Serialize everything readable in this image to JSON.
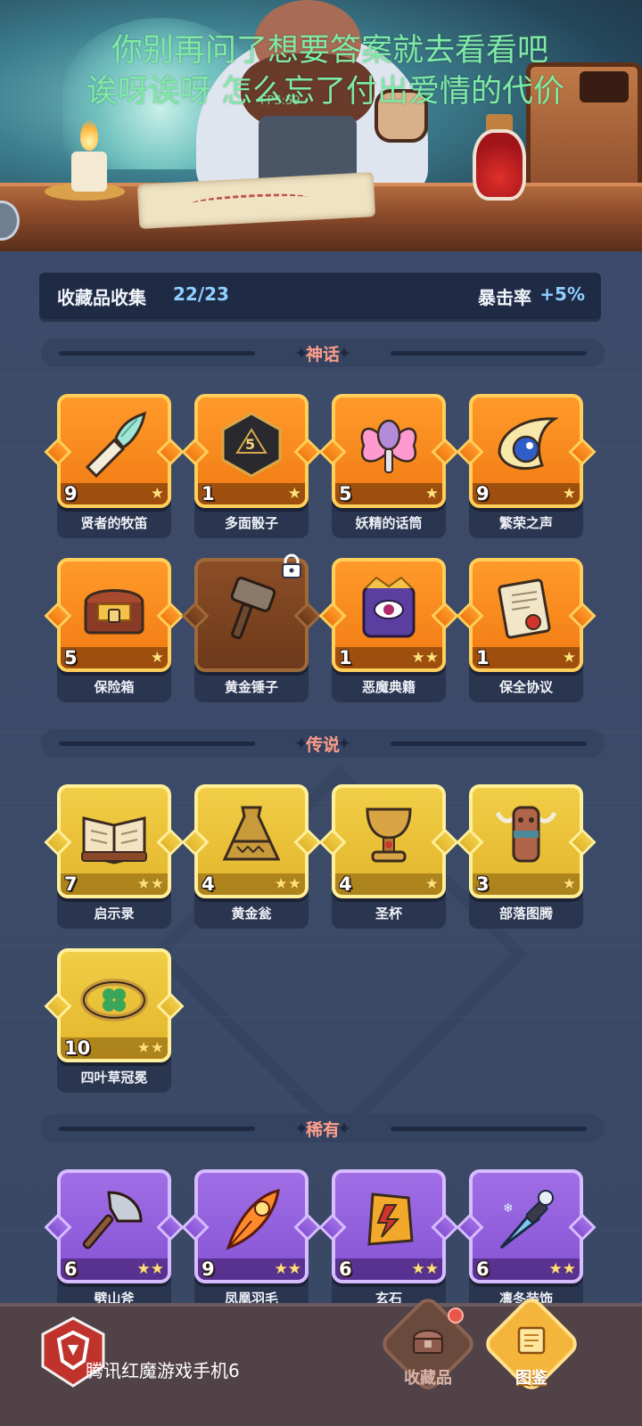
{
  "overlay": {
    "lyric_line1": "你别再问了想要答案就去看看吧",
    "lyric_line2": "诶呀诶呀 怎么忘了付出爱情的代价",
    "fps": "FPS:59"
  },
  "stats": {
    "label": "收藏品收集",
    "count": "22/23",
    "crit_label": "暴击率",
    "crit_value": "+5%"
  },
  "sections": {
    "mythic": {
      "title": "神话",
      "items": [
        {
          "name": "贤者的牧笛",
          "level": "9",
          "stars": "★",
          "icon": "flute-icon"
        },
        {
          "name": "多面骰子",
          "level": "1",
          "stars": "★",
          "icon": "dice-icon"
        },
        {
          "name": "妖精的话筒",
          "level": "5",
          "stars": "★",
          "icon": "fairy-microphone-icon"
        },
        {
          "name": "繁荣之声",
          "level": "9",
          "stars": "★",
          "icon": "horn-icon"
        },
        {
          "name": "保险箱",
          "level": "5",
          "stars": "★",
          "icon": "treasure-chest-icon"
        },
        {
          "name": "黄金锤子",
          "level": "",
          "stars": "",
          "icon": "hammer-icon",
          "locked": true
        },
        {
          "name": "恶魔典籍",
          "level": "1",
          "stars": "★★",
          "icon": "demon-book-icon"
        },
        {
          "name": "保全协议",
          "level": "1",
          "stars": "★",
          "icon": "contract-icon"
        }
      ]
    },
    "legend": {
      "title": "传说",
      "items": [
        {
          "name": "启示录",
          "level": "7",
          "stars": "★★",
          "icon": "open-book-icon"
        },
        {
          "name": "黄金瓮",
          "level": "4",
          "stars": "★★",
          "icon": "golden-urn-icon"
        },
        {
          "name": "圣杯",
          "level": "4",
          "stars": "★",
          "icon": "chalice-icon"
        },
        {
          "name": "部落图腾",
          "level": "3",
          "stars": "★",
          "icon": "totem-icon"
        },
        {
          "name": "四叶草冠冕",
          "level": "10",
          "stars": "★★",
          "icon": "clover-crown-icon"
        }
      ]
    },
    "rare": {
      "title": "稀有",
      "items": [
        {
          "name": "劈山斧",
          "level": "6",
          "stars": "★★",
          "icon": "axe-icon"
        },
        {
          "name": "凤凰羽毛",
          "level": "9",
          "stars": "★★",
          "icon": "phoenix-feather-icon"
        },
        {
          "name": "玄石",
          "level": "6",
          "stars": "★★",
          "icon": "mystic-stone-icon"
        },
        {
          "name": "凛冬装饰",
          "level": "6",
          "stars": "★★",
          "icon": "winter-dagger-icon"
        }
      ]
    }
  },
  "bottom_nav": {
    "brand_text": "腾讯红魔游戏手机6",
    "collect_tab": "收藏品",
    "codex_tab": "图鉴"
  },
  "colors": {
    "mythic": "#f07a12",
    "legend": "#e2b52c",
    "rare": "#8553d4",
    "section_title": "#ff9d8a",
    "accent_value": "#8fd0ff",
    "lyric": "#7eeaa6"
  }
}
